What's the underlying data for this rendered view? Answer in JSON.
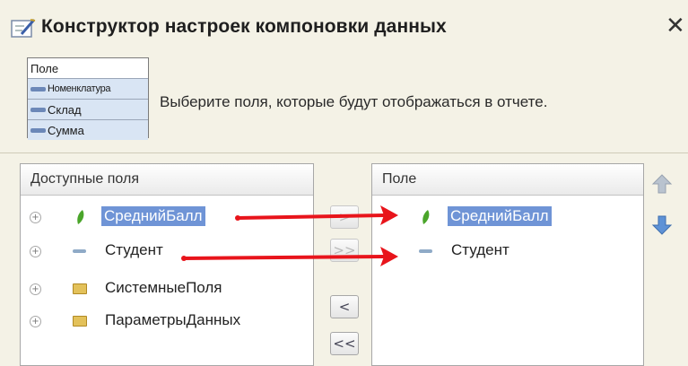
{
  "window": {
    "title": "Конструктор настроек компоновки данных",
    "close_glyph": "✕"
  },
  "info": {
    "preview_header": "Поле",
    "preview_rows": [
      "Номенклатура",
      "Склад",
      "Сумма"
    ],
    "text": "Выберите поля, которые будут отображаться в отчете."
  },
  "available": {
    "header": "Доступные поля",
    "items": [
      {
        "label": "СреднийБалл",
        "icon": "leaf-icon",
        "selected": true
      },
      {
        "label": "Студент",
        "icon": "dash-icon",
        "selected": false
      },
      {
        "label": "СистемныеПоля",
        "icon": "folder-icon",
        "selected": false
      },
      {
        "label": "ПараметрыДанных",
        "icon": "folder-icon",
        "selected": false
      }
    ],
    "expander_glyph": "+"
  },
  "move_buttons": {
    "add": ">",
    "add_all": ">>",
    "remove": "<",
    "remove_all": "<<"
  },
  "selected": {
    "header": "Поле",
    "items": [
      {
        "label": "СреднийБалл",
        "icon": "leaf-icon",
        "selected": true
      },
      {
        "label": "Студент",
        "icon": "dash-icon",
        "selected": false
      }
    ]
  },
  "colors": {
    "selection": "#6f94d6",
    "arrow": "#e8141b",
    "background": "#f4f2e6"
  }
}
